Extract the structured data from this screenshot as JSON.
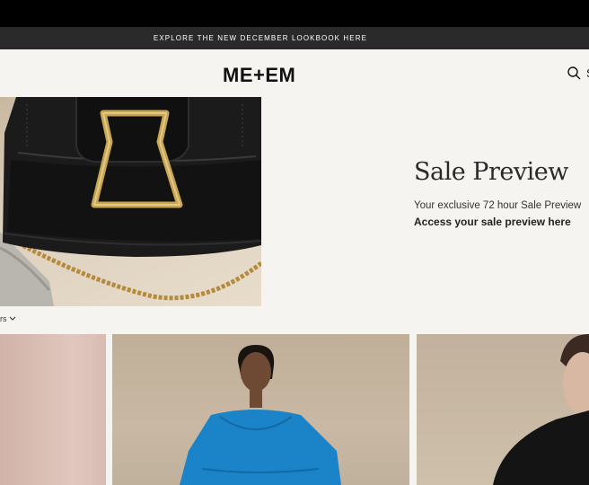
{
  "promo": {
    "text": "EXPLORE THE NEW DECEMBER LOOKBOOK HERE"
  },
  "header": {
    "logo": "ME+EM",
    "search_label": "S"
  },
  "hero": {
    "title": "Sale Preview",
    "subtitle": "Your exclusive 72 hour Sale Preview",
    "link": "Access your sale preview here"
  },
  "filter": {
    "label": "rs"
  },
  "colors": {
    "background": "#f6f4f0",
    "promo_bar": "#2a2a2a",
    "text": "#111111"
  }
}
